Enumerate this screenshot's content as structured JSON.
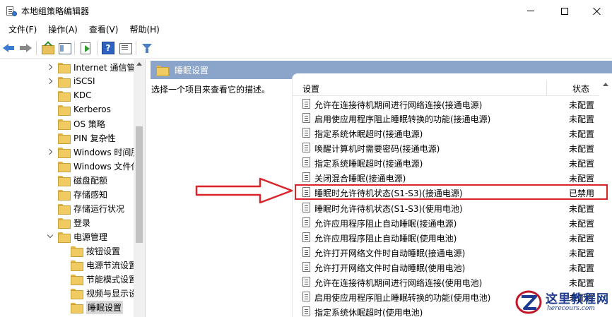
{
  "window": {
    "title": "本地组策略编辑器"
  },
  "menu": {
    "items": [
      "文件(F)",
      "操作(A)",
      "查看(V)",
      "帮助(H)"
    ]
  },
  "toolbar": {
    "help_glyph": "?"
  },
  "tree": {
    "items": [
      {
        "label": "Internet 通信管",
        "expander": "closed",
        "level": 1
      },
      {
        "label": "iSCSI",
        "expander": "closed",
        "level": 1
      },
      {
        "label": "KDC",
        "expander": "none",
        "level": 1
      },
      {
        "label": "Kerberos",
        "expander": "none",
        "level": 1
      },
      {
        "label": "OS 策略",
        "expander": "none",
        "level": 1
      },
      {
        "label": "PIN 复杂性",
        "expander": "none",
        "level": 1
      },
      {
        "label": "Windows 时间服",
        "expander": "closed",
        "level": 1
      },
      {
        "label": "Windows 文件保",
        "expander": "none",
        "level": 1
      },
      {
        "label": "磁盘配额",
        "expander": "none",
        "level": 1
      },
      {
        "label": "存储感知",
        "expander": "none",
        "level": 1
      },
      {
        "label": "存储运行状况",
        "expander": "none",
        "level": 1
      },
      {
        "label": "登录",
        "expander": "none",
        "level": 1
      },
      {
        "label": "电源管理",
        "expander": "open",
        "level": 1
      },
      {
        "label": "按钮设置",
        "expander": "none",
        "level": 2
      },
      {
        "label": "电源节流设置",
        "expander": "none",
        "level": 2
      },
      {
        "label": "节能模式设置",
        "expander": "none",
        "level": 2
      },
      {
        "label": "视频与显示设",
        "expander": "none",
        "level": 2
      },
      {
        "label": "睡眠设置",
        "expander": "none",
        "level": 2,
        "selected": true
      }
    ]
  },
  "right_pane": {
    "header_title": "睡眠设置",
    "description": "选择一个项目来查看它的描述。",
    "columns": {
      "setting": "设置",
      "status": "状态"
    },
    "rows": [
      {
        "name": "允许在连接待机期间进行网络连接(接通电源)",
        "status": "未配置"
      },
      {
        "name": "启用使应用程序阻止睡眠转换的功能(接通电源)",
        "status": "未配置"
      },
      {
        "name": "指定系统休眠超时(接通电源)",
        "status": "未配置"
      },
      {
        "name": "唤醒计算机时需要密码(接通电源)",
        "status": "未配置"
      },
      {
        "name": "指定系统睡眠超时(接通电源)",
        "status": "未配置"
      },
      {
        "name": "关闭混合睡眠(接通电源)",
        "status": "未配置"
      },
      {
        "name": "睡眠时允许待机状态(S1-S3)(接通电源)",
        "status": "已禁用",
        "highlighted": true
      },
      {
        "name": "睡眠时允许待机状态(S1-S3)(使用电池)",
        "status": "未配置"
      },
      {
        "name": "允许应用程序阻止自动睡眠(接通电源)",
        "status": "未配置"
      },
      {
        "name": "允许应用程序阻止自动睡眠(使用电池)",
        "status": "未配置"
      },
      {
        "name": "允许打开网络文件时自动睡眠(接通电源)",
        "status": "未配置"
      },
      {
        "name": "允许打开网络文件时自动睡眠(使用电池)",
        "status": "未配置"
      },
      {
        "name": "允许在连接待机期间进行网络连接(使用电池)",
        "status": "未配置"
      },
      {
        "name": "启用使应用程序阻止睡眠转换的功能(使用电池)",
        "status": "未配置"
      },
      {
        "name": "指定系统休眠超时(使用电池)",
        "status": ""
      }
    ]
  },
  "annotation": {
    "highlight_color": "#d9242b"
  },
  "watermark": {
    "title": "这里教程网",
    "url": "herecours.com"
  },
  "colors": {
    "header_bar": "#8ba4c9",
    "folder": "#f0cb62",
    "selection": "#d9d9d9"
  }
}
